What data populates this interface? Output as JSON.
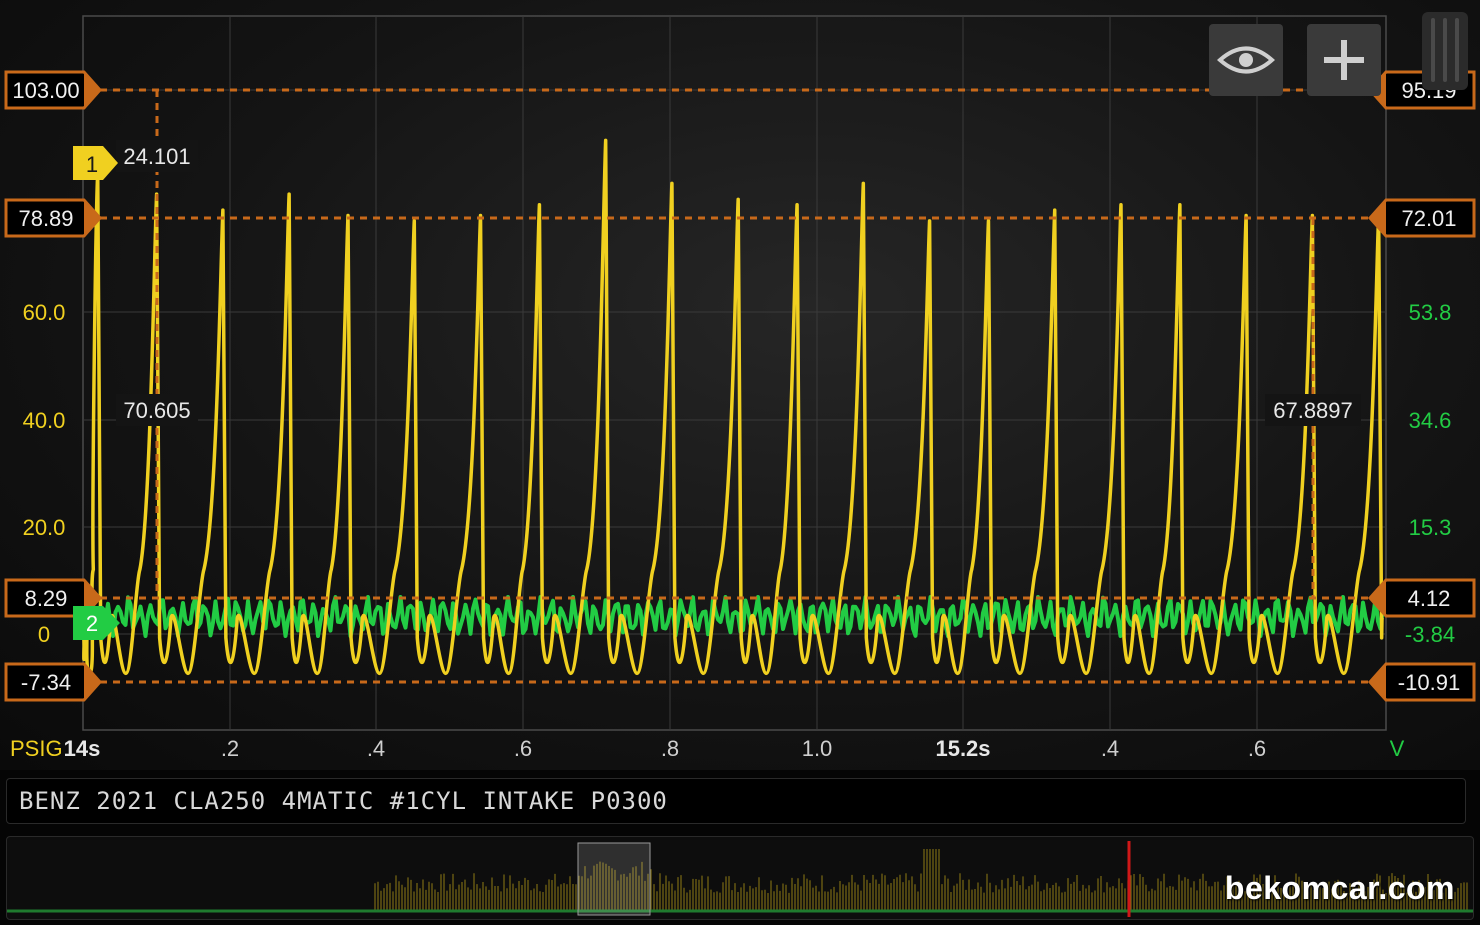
{
  "left_axis": {
    "unit_label": "PSIG",
    "tick_labels": [
      "60.0",
      "40.0",
      "20.0",
      "0"
    ],
    "color": "#f0d020"
  },
  "right_axis": {
    "unit_label": "V",
    "tick_labels": [
      "53.8",
      "34.6",
      "15.3",
      "-3.84"
    ],
    "color": "#22cc44"
  },
  "x_axis": {
    "tick_labels": [
      "14s",
      ".2",
      ".4",
      ".6",
      ".8",
      "1.0",
      "15.2s",
      ".4",
      ".6"
    ]
  },
  "cursors": {
    "left_values": [
      "103.00",
      "78.89",
      "8.29",
      "-7.34"
    ],
    "right_values": [
      "95.19",
      "72.01",
      "4.12",
      "-10.91"
    ],
    "vertical_readouts": [
      "24.101",
      "70.605",
      "67.8897"
    ],
    "color": "#c8691a"
  },
  "channel_markers": [
    "1",
    "2"
  ],
  "buttons": {
    "eye_icon": "eye-icon",
    "add_icon": "plus-icon"
  },
  "title": "BENZ 2021 CLA250 4MATIC #1CYL INTAKE P0300",
  "watermark": "bekomcar.com",
  "chart_data": {
    "type": "line",
    "xlim": [
      14.0,
      15.77
    ],
    "series": [
      {
        "axis": "left",
        "color": "#f0d020",
        "description_values": "yellow channel 1 intake pressure spikes (PSIG)",
        "x": [
          14.02,
          14.1,
          14.19,
          14.28,
          14.36,
          14.45,
          14.54,
          14.62,
          14.71,
          14.8,
          14.89,
          14.97,
          15.06,
          15.15,
          15.23,
          15.32,
          15.41,
          15.49,
          15.58,
          15.67,
          15.76
        ],
        "values": [
          86,
          82,
          79,
          82,
          78,
          77,
          78,
          80,
          92,
          84,
          81,
          80,
          84,
          77,
          77,
          79,
          80,
          80,
          78,
          78,
          78
        ],
        "baseline_min": -7.34
      },
      {
        "axis": "right",
        "color": "#22cc44",
        "description_values": "green channel 2 signal oscillating",
        "range": [
          -3.84,
          4.12
        ]
      }
    ]
  }
}
